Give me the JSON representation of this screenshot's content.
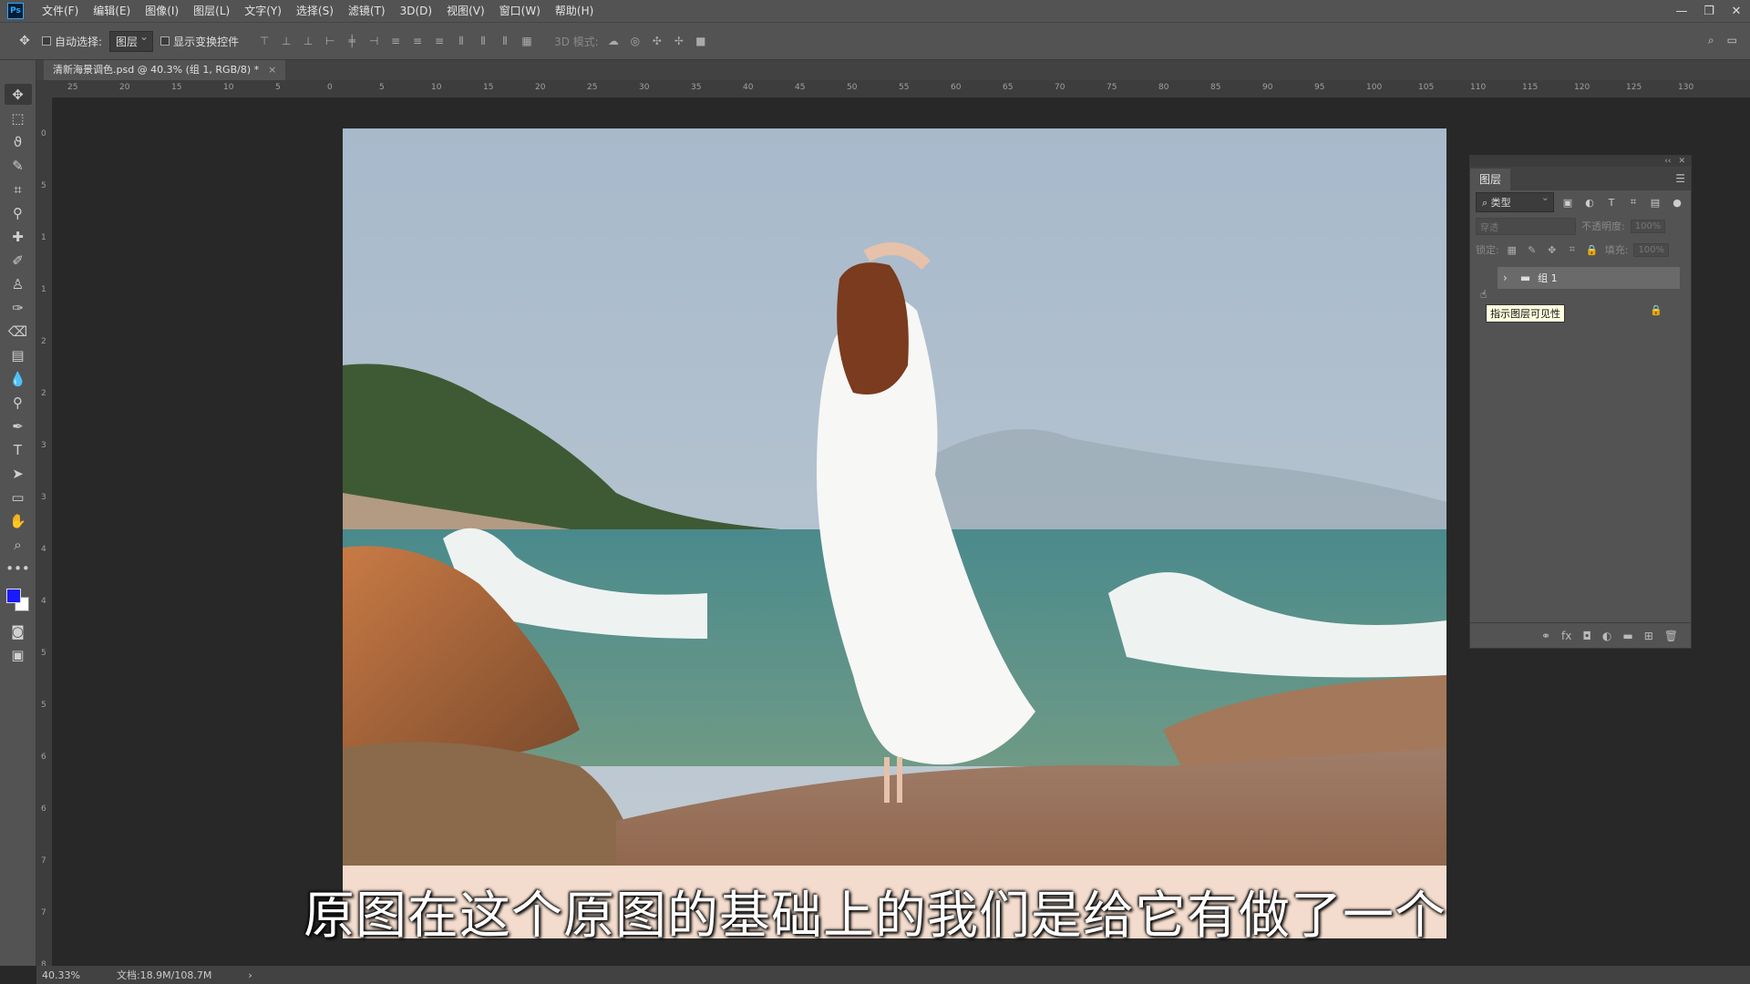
{
  "menubar": {
    "app_icon": "Ps",
    "items": [
      "文件(F)",
      "编辑(E)",
      "图像(I)",
      "图层(L)",
      "文字(Y)",
      "选择(S)",
      "滤镜(T)",
      "3D(D)",
      "视图(V)",
      "窗口(W)",
      "帮助(H)"
    ]
  },
  "options": {
    "auto_select_label": "自动选择:",
    "auto_select_target": "图层",
    "show_transform_label": "显示变换控件",
    "mode_3d_label": "3D 模式:"
  },
  "document": {
    "tab_title": "清新海景调色.psd @ 40.3% (组 1, RGB/8) *"
  },
  "ruler": {
    "top_ticks": [
      "25",
      "20",
      "15",
      "10",
      "5",
      "0",
      "5",
      "10",
      "15",
      "20",
      "25",
      "30",
      "35",
      "40",
      "45",
      "50",
      "55",
      "60",
      "65",
      "70",
      "75",
      "80",
      "85",
      "90",
      "95",
      "100",
      "105",
      "110",
      "115",
      "120",
      "125",
      "130"
    ],
    "left_ticks": [
      "0",
      "5",
      "1",
      "1",
      "2",
      "2",
      "3",
      "3",
      "4",
      "4",
      "5",
      "5",
      "6",
      "6",
      "7",
      "7",
      "8"
    ]
  },
  "canvas": {
    "subtitle": "原图在这个原图的基础上的我们是给它有做了一个"
  },
  "layers_panel": {
    "tab_label": "图层",
    "filter_kind": "类型",
    "blend_mode": "穿透",
    "opacity_label": "不透明度:",
    "opacity_value": "100%",
    "lock_label": "锁定:",
    "fill_label": "填充:",
    "fill_value": "100%",
    "layers": [
      {
        "name": "组 1"
      }
    ],
    "tooltip": "指示图层可见性"
  },
  "status": {
    "zoom": "40.33%",
    "doc_size": "文档:18.9M/108.7M"
  },
  "colors": {
    "foreground": "#1a1aff",
    "background": "#ffffff"
  }
}
